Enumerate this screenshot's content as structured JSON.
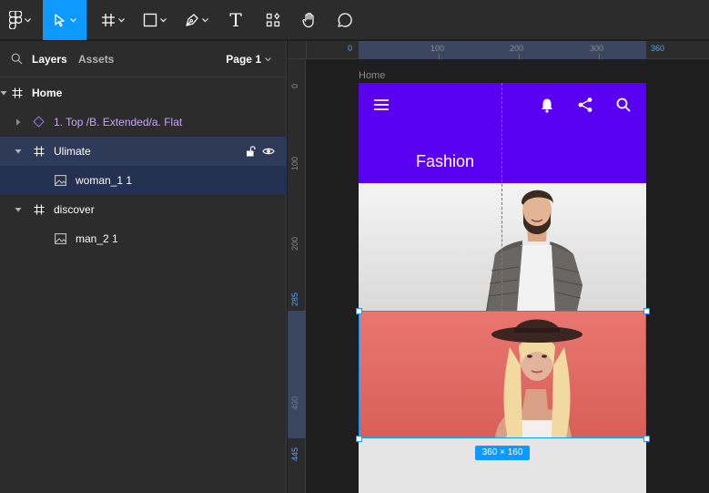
{
  "toolbar": {
    "tools": [
      {
        "name": "main-menu",
        "icon": "figma-logo-icon"
      },
      {
        "name": "move-tool",
        "icon": "cursor-arrow-icon",
        "active": true
      },
      {
        "name": "frame-tool",
        "icon": "hash-frame-icon"
      },
      {
        "name": "shape-tool",
        "icon": "rectangle-icon"
      },
      {
        "name": "pen-tool",
        "icon": "pen-icon"
      },
      {
        "name": "text-tool",
        "icon": "text-icon",
        "glyph": "T"
      },
      {
        "name": "resources-tool",
        "icon": "components-icon"
      },
      {
        "name": "hand-tool",
        "icon": "hand-icon"
      },
      {
        "name": "comment-tool",
        "icon": "comment-icon"
      }
    ]
  },
  "panel": {
    "tabs": {
      "layers": "Layers",
      "assets": "Assets"
    },
    "page_select": "Page 1",
    "layers": [
      {
        "label": "Home",
        "type": "frame"
      },
      {
        "label": "1. Top /B. Extended/a. Flat",
        "type": "component"
      },
      {
        "label": "Ulimate",
        "type": "frame"
      },
      {
        "label": "woman_1 1",
        "type": "image"
      },
      {
        "label": "discover",
        "type": "frame"
      },
      {
        "label": "man_2 1",
        "type": "image"
      }
    ]
  },
  "rulers": {
    "top": [
      "0",
      "100",
      "200",
      "300",
      "360"
    ],
    "left": [
      "0",
      "100",
      "200",
      "285",
      "400",
      "445"
    ]
  },
  "canvas": {
    "frame_label": "Home",
    "appbar_title": "Fashion",
    "selection_size": "360 × 160"
  },
  "colors": {
    "accent": "#0d99ff",
    "appbar": "#5a00f0",
    "ulimate_bg": "#e06a64",
    "component_text": "#c7a2ff"
  }
}
